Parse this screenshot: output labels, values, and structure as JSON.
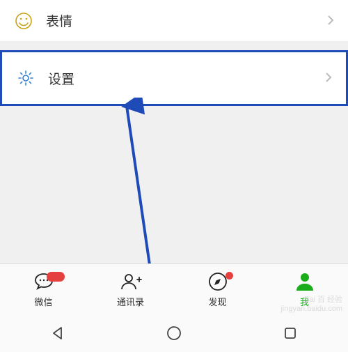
{
  "list": {
    "emoji": {
      "label": "表情"
    },
    "settings": {
      "label": "设置"
    }
  },
  "tabs": {
    "chat": {
      "label": "微信"
    },
    "contacts": {
      "label": "通讯录"
    },
    "discover": {
      "label": "发现"
    },
    "me": {
      "label": "我"
    }
  },
  "colors": {
    "accent": "#1aad19",
    "highlight": "#1e4bb8",
    "badge": "#e63f3f"
  },
  "watermark": {
    "line1": "Bai 百 经验",
    "line2": "jingyan.baidu.com"
  }
}
